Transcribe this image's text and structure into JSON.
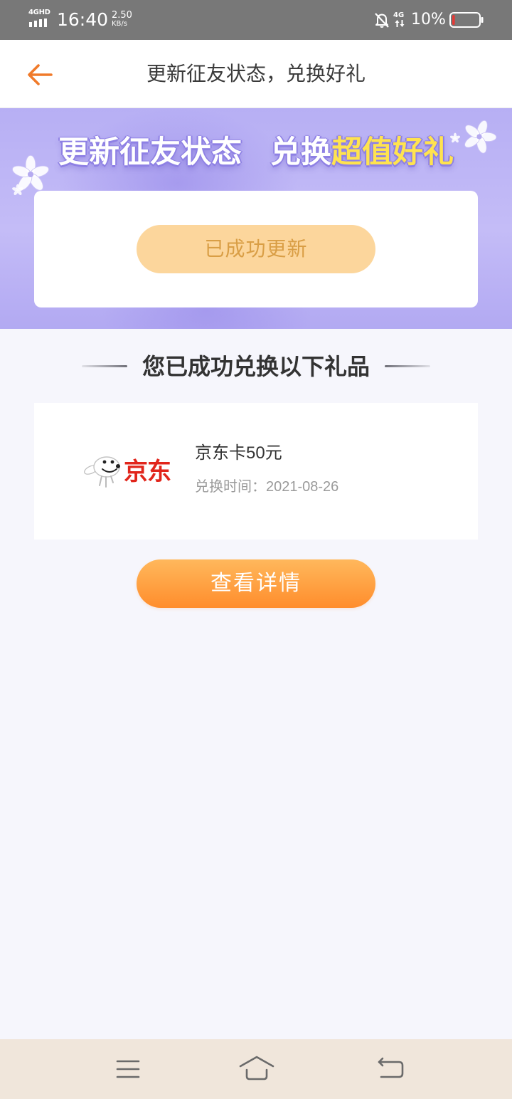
{
  "status_bar": {
    "network_type": "4GHD",
    "time": "16:40",
    "speed_value": "2.50",
    "speed_unit": "KB/s",
    "data_network": "4G",
    "battery_percent": "10%",
    "battery_level": 0.1,
    "icons": [
      "signal-icon",
      "mute-bell-icon",
      "data-arrows-icon",
      "battery-icon"
    ]
  },
  "header": {
    "title": "更新征友状态，兑换好礼",
    "back_icon": "back-arrow-icon"
  },
  "banner": {
    "title_main": "更新征友状态",
    "title_prefix": "兑换",
    "title_highlight": "超值好礼",
    "status_button": "已成功更新",
    "decorations": [
      "flower-icon",
      "flower-icon",
      "small-flower-icon",
      "small-flower-icon"
    ]
  },
  "gifts_section": {
    "heading": "您已成功兑换以下礼品",
    "items": [
      {
        "logo_icon": "jd-mascot-icon",
        "logo_text": "京东",
        "name": "京东卡50元",
        "time_label": "兑换时间：",
        "time": "2021-08-26"
      }
    ]
  },
  "details_button": "查看详情",
  "nav_bar": {
    "icons": [
      "menu-icon",
      "home-icon",
      "return-icon"
    ]
  },
  "colors": {
    "status_bar_bg": "#787878",
    "accent_orange": "#ff8d2c",
    "banner_purple": "#b7aff4",
    "highlight_yellow": "#ffe34f",
    "status_button_bg": "#fcd69c",
    "status_button_text": "#d99e45",
    "brand_red": "#e1251b",
    "page_bg": "#f6f6fc",
    "nav_bg": "#f0e6db",
    "back_arrow": "#f07a2a"
  }
}
